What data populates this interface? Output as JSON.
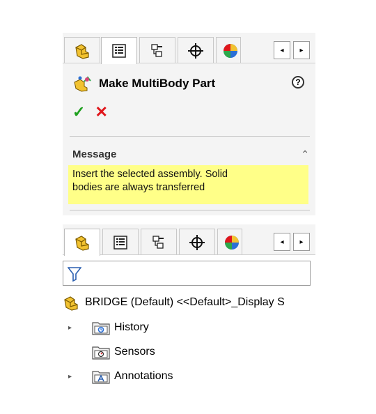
{
  "property_panel": {
    "tabs": [
      {
        "icon": "part-icon"
      },
      {
        "icon": "property-manager-icon"
      },
      {
        "icon": "configuration-manager-icon"
      },
      {
        "icon": "dimxpert-icon"
      },
      {
        "icon": "display-manager-icon"
      }
    ],
    "scroll_left": "◂",
    "scroll_right": "▸",
    "title": "Make MultiBody Part",
    "help": "?",
    "ok": "✓",
    "cancel": "✕",
    "message_section": {
      "title": "Message",
      "collapse": "⌃",
      "text_line1": "Insert the selected assembly. Solid",
      "text_line2": "bodies are always transferred"
    },
    "message_bg": "#ffff88"
  },
  "feature_tree": {
    "tabs": [
      {
        "icon": "part-icon"
      },
      {
        "icon": "property-manager-icon"
      },
      {
        "icon": "configuration-manager-icon"
      },
      {
        "icon": "dimxpert-icon"
      },
      {
        "icon": "display-manager-icon"
      }
    ],
    "scroll_left": "◂",
    "scroll_right": "▸",
    "root_label": "BRIDGE (Default) <<Default>_Display S",
    "items": [
      {
        "label": "History",
        "expander": "▸",
        "icon": "history-folder-icon"
      },
      {
        "label": "Sensors",
        "expander": "",
        "icon": "sensors-folder-icon"
      },
      {
        "label": "Annotations",
        "expander": "▸",
        "icon": "annotations-folder-icon"
      }
    ]
  },
  "colors": {
    "ok_green": "#1fa01f",
    "cancel_red": "#e0161b",
    "part_yellow": "#f2c230"
  }
}
